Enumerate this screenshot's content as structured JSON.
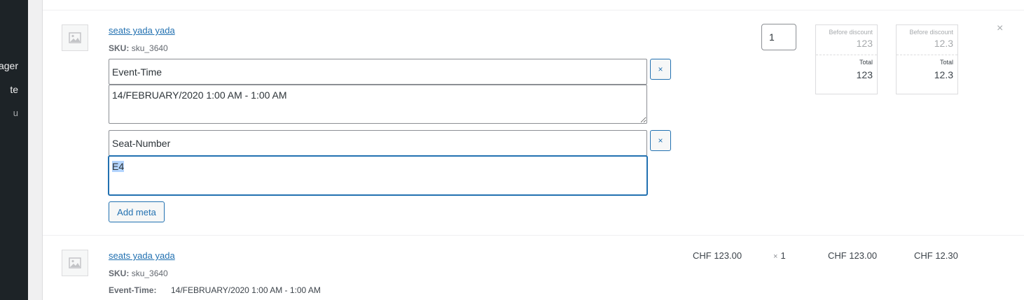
{
  "sidebar": {
    "items": [
      {
        "label": "ager"
      },
      {
        "label": "te"
      },
      {
        "label": "u"
      }
    ]
  },
  "item_edit": {
    "name": "seats yada yada",
    "sku_label": "SKU:",
    "sku_value": "sku_3640",
    "meta": [
      {
        "key": "Event-Time",
        "value": "14/FEBRUARY/2020 1:00 AM - 1:00 AM",
        "remove_label": "×"
      },
      {
        "key": "Seat-Number",
        "value": "E4",
        "remove_label": "×"
      }
    ],
    "add_meta_label": "Add meta",
    "quantity": "1",
    "price_boxes": [
      {
        "before_label": "Before discount",
        "before_value": "123",
        "total_label": "Total",
        "total_value": "123"
      },
      {
        "before_label": "Before discount",
        "before_value": "12.3",
        "total_label": "Total",
        "total_value": "12.3"
      }
    ],
    "delete_label": "×"
  },
  "item_view": {
    "name": "seats yada yada",
    "sku_label": "SKU:",
    "sku_value": "sku_3640",
    "cost": "CHF 123.00",
    "qty_prefix": "×",
    "qty": "1",
    "total": "CHF 123.00",
    "tax": "CHF 12.30",
    "meta": [
      {
        "key": "Event-Time:",
        "value": "14/FEBRUARY/2020 1:00 AM - 1:00 AM"
      }
    ]
  }
}
